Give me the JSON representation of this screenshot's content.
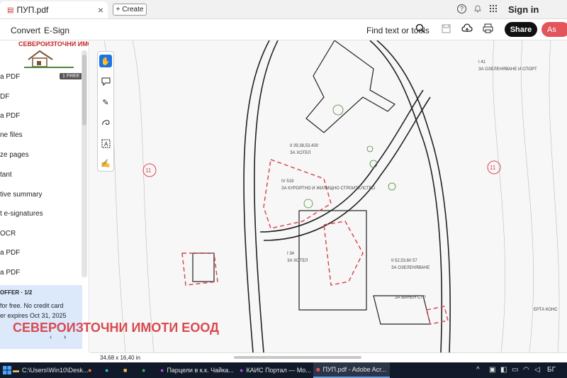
{
  "browser_tab": {
    "title": "ПУП.pdf",
    "close": "×"
  },
  "create_button": {
    "label": "Create",
    "icon": "plus-icon"
  },
  "header_icons": {
    "help": "?",
    "bell": "bell-icon",
    "apps": "grid-icon"
  },
  "signin": {
    "label": "Sign in"
  },
  "toolbar": {
    "convert": "Convert",
    "esign": "E-Sign",
    "find": "Find text or tools"
  },
  "share": {
    "label": "Share"
  },
  "ai": {
    "label": "As"
  },
  "sidebar": {
    "logo_text": "СЕВЕРОИЗТОЧНИ ИМОТИ",
    "free_badge": "1 FREE",
    "items": [
      {
        "label": "a PDF"
      },
      {
        "label": "DF"
      },
      {
        "label": "a PDF"
      },
      {
        "label": "ne files"
      },
      {
        "label": "ze pages"
      },
      {
        "label": "tant"
      },
      {
        "label": "tive summary"
      },
      {
        "label": "t e-signatures"
      },
      {
        "label": "OCR"
      },
      {
        "label": "a PDF"
      },
      {
        "label": "a PDF"
      }
    ]
  },
  "offer": {
    "title": "OFFER · 1/2",
    "line1": "for free. No credit card",
    "line2": "er expires Oct 31, 2025",
    "prev": "‹",
    "next": "›"
  },
  "statusbar": {
    "page_size": "34,68 x 16,40 in"
  },
  "watermark": {
    "text": "СЕВЕРОИЗТОЧНИ ИМОТИ ЕООД"
  },
  "map_labels": {
    "zone1": "I 41",
    "zone1_desc": "ЗА ОЗЕЛЕНЯВАНЕ И СПОРТ",
    "hotel1": "II 39,38,53,430",
    "hotel1_desc": "ЗА ХОТЕЛ",
    "resort": "IV 519",
    "resort_desc": "ЗА КУРОРТНО И ЖИЛИЩНО СТРОИТЕЛСТВО",
    "hotel2": "I 34",
    "hotel2_desc": "ЗА ХОТЕЛ",
    "green2": "II 52,53,60 57",
    "green2_desc": "ЗА ОЗЕЛЕНЯВАНЕ",
    "vino": "ЗА ВИНЕН СТР",
    "road": "11",
    "erta": "ЕРТА КОНС"
  },
  "taskbar": {
    "items": [
      {
        "label": "C:\\Users\\Win10\\Desk..."
      },
      {
        "label": "Парцели в к.к. Чайка..."
      },
      {
        "label": "КАИС Портал — Мо..."
      },
      {
        "label": "ПУП.pdf - Adobe Acr..."
      }
    ],
    "lang": "БГ"
  }
}
